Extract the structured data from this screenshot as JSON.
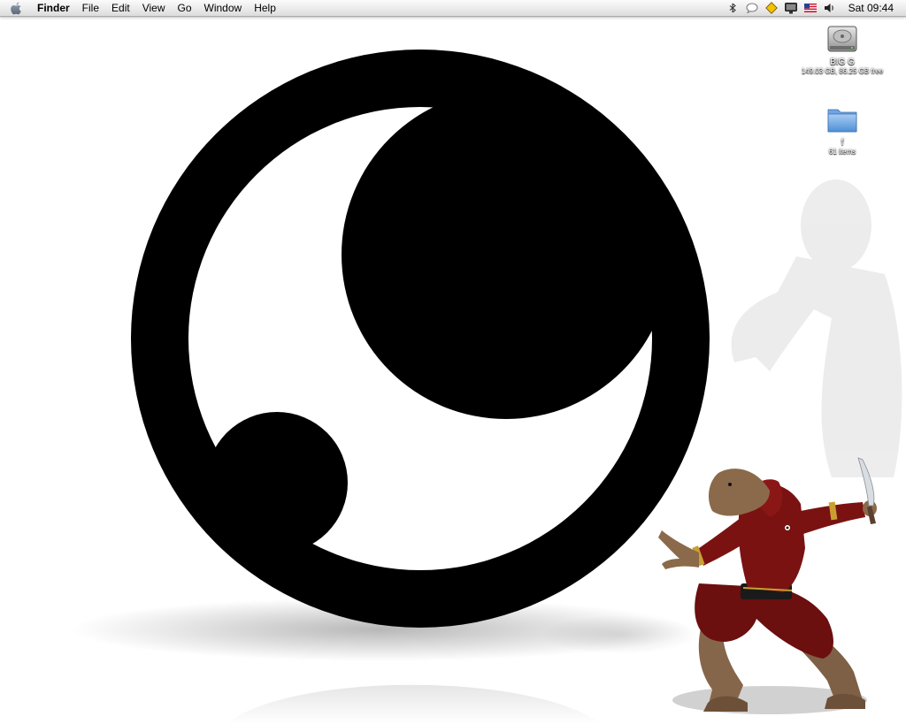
{
  "menubar": {
    "app_name": "Finder",
    "menus": [
      "File",
      "Edit",
      "View",
      "Go",
      "Window",
      "Help"
    ],
    "clock": "Sat 09:44",
    "extras": [
      "bluetooth-icon",
      "speech-icon",
      "warning-icon",
      "display-icon",
      "us-flag-icon",
      "volume-icon"
    ]
  },
  "desktop": {
    "icons": [
      {
        "name": "BIG G",
        "info": "149.03 GB, 86.25 GB free",
        "icon": "hard-drive-icon"
      },
      {
        "name": "f",
        "info": "61 items",
        "icon": "folder-icon"
      }
    ]
  },
  "colors": {
    "background": "#ffffff",
    "emblem": "#000000",
    "robe": "#6b0f0f",
    "skin": "#8a6a4a",
    "trim": "#c9a030"
  }
}
